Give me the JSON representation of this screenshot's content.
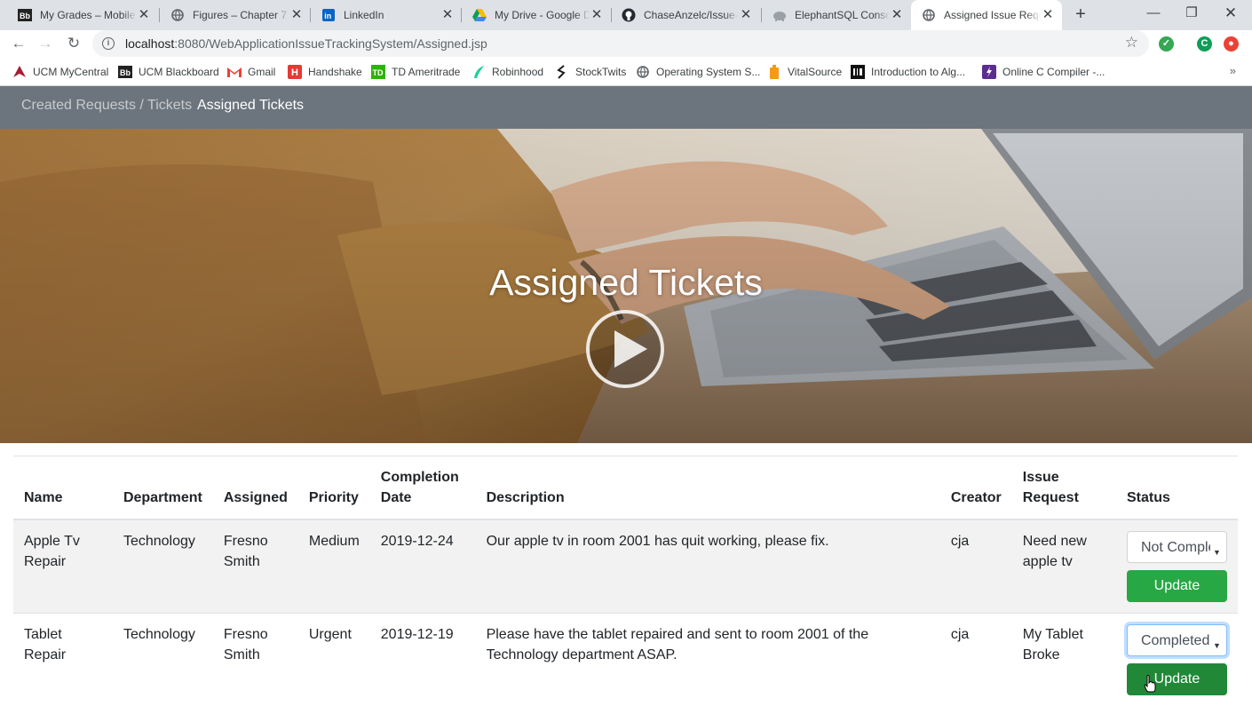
{
  "browser": {
    "tabs": [
      {
        "title": "My Grades – Mobile",
        "icon": "blackboard-icon"
      },
      {
        "title": "Figures – Chapter 7",
        "icon": "globe-icon"
      },
      {
        "title": "LinkedIn",
        "icon": "linkedin-icon"
      },
      {
        "title": "My Drive - Google Dr",
        "icon": "google-drive-icon"
      },
      {
        "title": "ChaseAnzelc/Issue-T",
        "icon": "github-icon"
      },
      {
        "title": "ElephantSQL Console",
        "icon": "elephantsql-icon"
      },
      {
        "title": "Assigned Issue Reque",
        "icon": "globe-icon",
        "active": true
      }
    ],
    "address": {
      "host": "localhost",
      "path": ":8080/WebApplicationIssueTrackingSystem/Assigned.jsp"
    },
    "profile_initial": "C",
    "bookmarks": [
      {
        "label": "UCM MyCentral",
        "icon": "ucm-icon"
      },
      {
        "label": "UCM Blackboard",
        "icon": "blackboard-icon"
      },
      {
        "label": "Gmail",
        "icon": "gmail-icon"
      },
      {
        "label": "Handshake",
        "icon": "handshake-icon"
      },
      {
        "label": "TD Ameritrade",
        "icon": "td-icon"
      },
      {
        "label": "Robinhood",
        "icon": "robinhood-icon"
      },
      {
        "label": "StockTwits",
        "icon": "stocktwits-icon"
      },
      {
        "label": "Operating System S...",
        "icon": "globe-icon"
      },
      {
        "label": "VitalSource",
        "icon": "vitalsource-icon"
      },
      {
        "label": "Introduction to Alg...",
        "icon": "book-icon"
      },
      {
        "label": "Online C Compiler -...",
        "icon": "compiler-icon"
      }
    ],
    "bookmarks_more": "»"
  },
  "navbar": {
    "links": [
      {
        "label": "Created Requests / Tickets",
        "active": false
      },
      {
        "label": "Assigned Tickets",
        "active": true
      }
    ]
  },
  "hero": {
    "title": "Assigned Tickets"
  },
  "table": {
    "headers": [
      "Name",
      "Department",
      "Assigned",
      "Priority",
      "Completion Date",
      "Description",
      "Creator",
      "Issue Request",
      "Status"
    ],
    "rows": [
      {
        "name": "Apple Tv Repair",
        "department": "Technology",
        "assigned": "Fresno Smith",
        "priority": "Medium",
        "completion_date": "2019-12-24",
        "description": "Our apple tv in room 2001 has quit working, please fix.",
        "creator": "cja",
        "issue_request": "Need new apple tv",
        "status": "Not Completed",
        "button": "Update"
      },
      {
        "name": "Tablet Repair",
        "department": "Technology",
        "assigned": "Fresno Smith",
        "priority": "Urgent",
        "completion_date": "2019-12-19",
        "description": "Please have the tablet repaired and sent to room 2001 of the Technology department ASAP.",
        "creator": "cja",
        "issue_request": "My Tablet Broke",
        "status": "Completed",
        "button": "Update"
      }
    ]
  },
  "colors": {
    "navbar": "#6c757d",
    "update_button": "#28a745",
    "row_stripe": "#f2f2f2"
  }
}
